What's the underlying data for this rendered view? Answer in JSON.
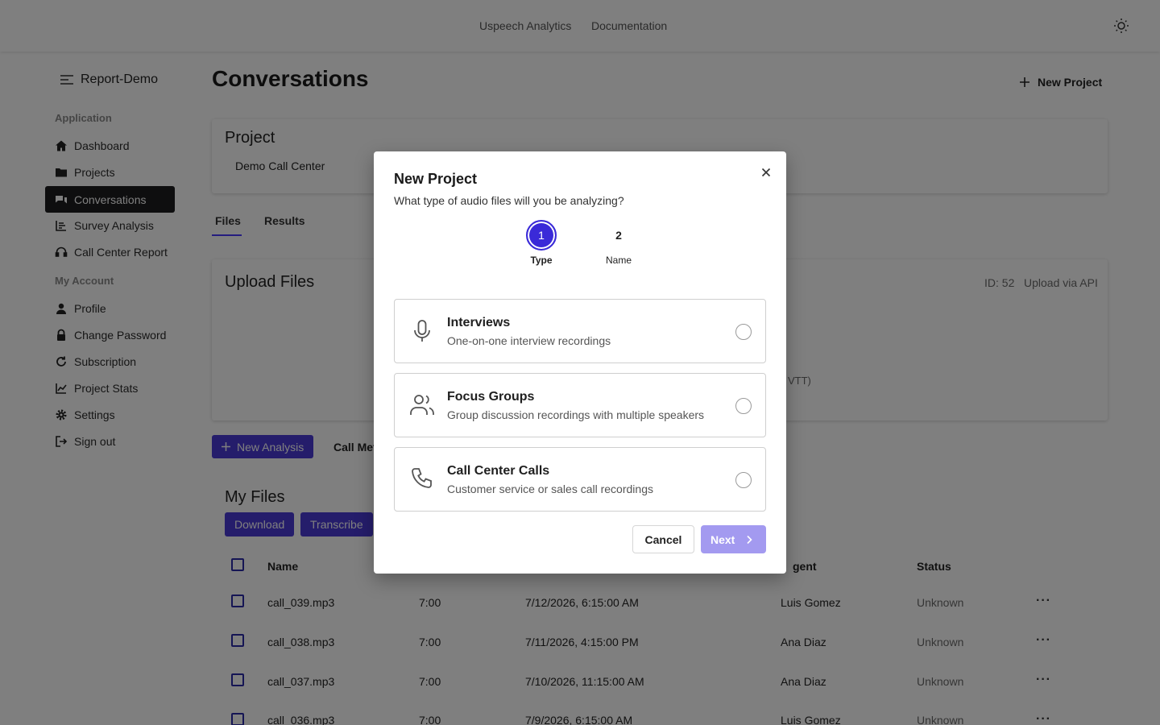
{
  "topbar": {
    "links": [
      "Uspeech Analytics",
      "Documentation"
    ],
    "theme_icon": "sun-icon"
  },
  "sidebar": {
    "brand": "Report-Demo",
    "section_application": "Application",
    "section_account": "My Account",
    "items": [
      {
        "label": "Dashboard",
        "icon": "home-icon"
      },
      {
        "label": "Projects",
        "icon": "folder-icon"
      },
      {
        "label": "Conversations",
        "icon": "chat-icon",
        "active": true
      },
      {
        "label": "Survey Analysis",
        "icon": "list-icon"
      },
      {
        "label": "Call Center Report",
        "icon": "headset-icon"
      },
      {
        "label": "Profile",
        "icon": "user-icon"
      },
      {
        "label": "Change Password",
        "icon": "lock-icon"
      },
      {
        "label": "Subscription",
        "icon": "refresh-icon"
      },
      {
        "label": "Project Stats",
        "icon": "chart-icon"
      },
      {
        "label": "Settings",
        "icon": "gear-icon"
      },
      {
        "label": "Sign out",
        "icon": "sign-out-icon"
      }
    ]
  },
  "main": {
    "title": "Conversations",
    "new_project_label": "New Project",
    "project_card_title": "Project",
    "project_name": "Demo Call Center",
    "tabs": [
      "Files",
      "Results"
    ],
    "upload_title": "Upload Files",
    "upload_id": "ID: 52",
    "upload_api": "Upload via API",
    "upload_hint_fragment": "VTT)",
    "new_analysis_label": "New Analysis",
    "call_metrics_fragment": "Call Met",
    "my_files_title": "My Files",
    "download_label": "Download",
    "transcribe_label": "Transcribe",
    "table": {
      "headers": {
        "name": "Name",
        "agent": "gent",
        "status": "Status"
      },
      "rows": [
        {
          "name": "call_039.mp3",
          "duration": "7:00",
          "date": "7/12/2026, 6:15:00 AM",
          "agent": "Luis Gomez",
          "status": "Unknown"
        },
        {
          "name": "call_038.mp3",
          "duration": "7:00",
          "date": "7/11/2026, 4:15:00 PM",
          "agent": "Ana Diaz",
          "status": "Unknown"
        },
        {
          "name": "call_037.mp3",
          "duration": "7:00",
          "date": "7/10/2026, 11:15:00 AM",
          "agent": "Ana Diaz",
          "status": "Unknown"
        },
        {
          "name": "call_036.mp3",
          "duration": "7:00",
          "date": "7/9/2026, 6:15:00 AM",
          "agent": "Luis Gomez",
          "status": "Unknown"
        }
      ]
    }
  },
  "modal": {
    "title": "New Project",
    "subtitle": "What type of audio files will you be analyzing?",
    "steps": [
      {
        "number": "1",
        "label": "Type"
      },
      {
        "number": "2",
        "label": "Name"
      }
    ],
    "options": [
      {
        "title": "Interviews",
        "description": "One-on-one interview recordings",
        "icon": "microphone-icon"
      },
      {
        "title": "Focus Groups",
        "description": "Group discussion recordings with multiple speakers",
        "icon": "users-icon"
      },
      {
        "title": "Call Center Calls",
        "description": "Customer service or sales call recordings",
        "icon": "phone-icon"
      }
    ],
    "cancel_label": "Cancel",
    "next_label": "Next"
  },
  "colors": {
    "accent": "#3a2ad8",
    "next_disabled": "#a39af0",
    "sidebar_active": "#1c1c1e"
  }
}
